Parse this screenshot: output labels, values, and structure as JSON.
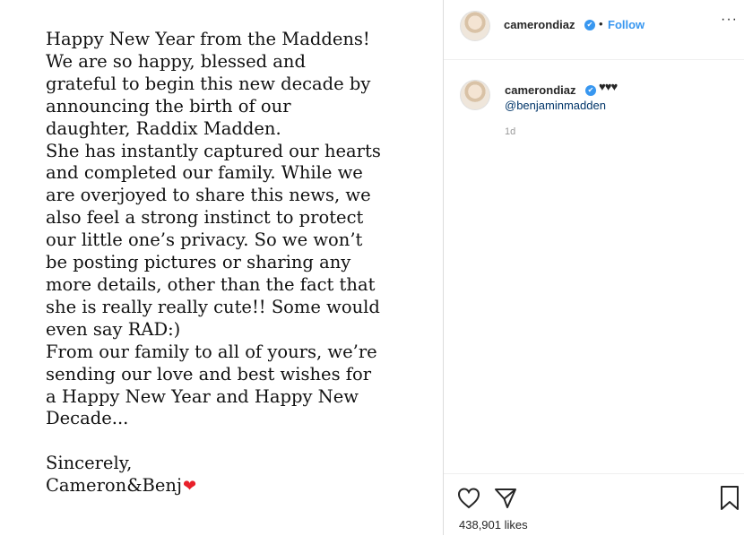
{
  "post": {
    "lines": [
      "Happy New Year from the Maddens!",
      "We are so happy, blessed and",
      "grateful to begin this new decade by",
      "announcing the birth of our",
      "daughter, Raddix Madden.",
      "She has instantly captured our hearts",
      "and completed our family. While we",
      "are overjoyed to share this news, we",
      "also feel a strong instinct to protect",
      "our little one’s privacy. So we won’t",
      "be posting pictures or sharing any",
      "more details, other than the fact that",
      "she is really really cute!! Some would",
      "even say RAD:)",
      "From our family to all of yours, we’re",
      "sending our love and best wishes for",
      "a Happy New Year and Happy New",
      "Decade..."
    ],
    "closing": "Sincerely,",
    "signature": "Cameron&Benj",
    "signature_emoji": "❤"
  },
  "header": {
    "username": "camerondiaz",
    "verified_glyph": "✔",
    "separator": "•",
    "follow_label": "Follow",
    "more_label": "···"
  },
  "comment": {
    "username": "camerondiaz",
    "verified_glyph": "✔",
    "hearts": "♥♥♥",
    "mention": "@benjaminmadden",
    "time": "1d"
  },
  "footer": {
    "likes": "438,901 likes",
    "icons": [
      "heart-outline-icon",
      "share-arrow-icon",
      "bookmark-icon"
    ]
  },
  "colors": {
    "accent": "#3897f0",
    "heart": "#e8202a",
    "mention": "#003569"
  }
}
